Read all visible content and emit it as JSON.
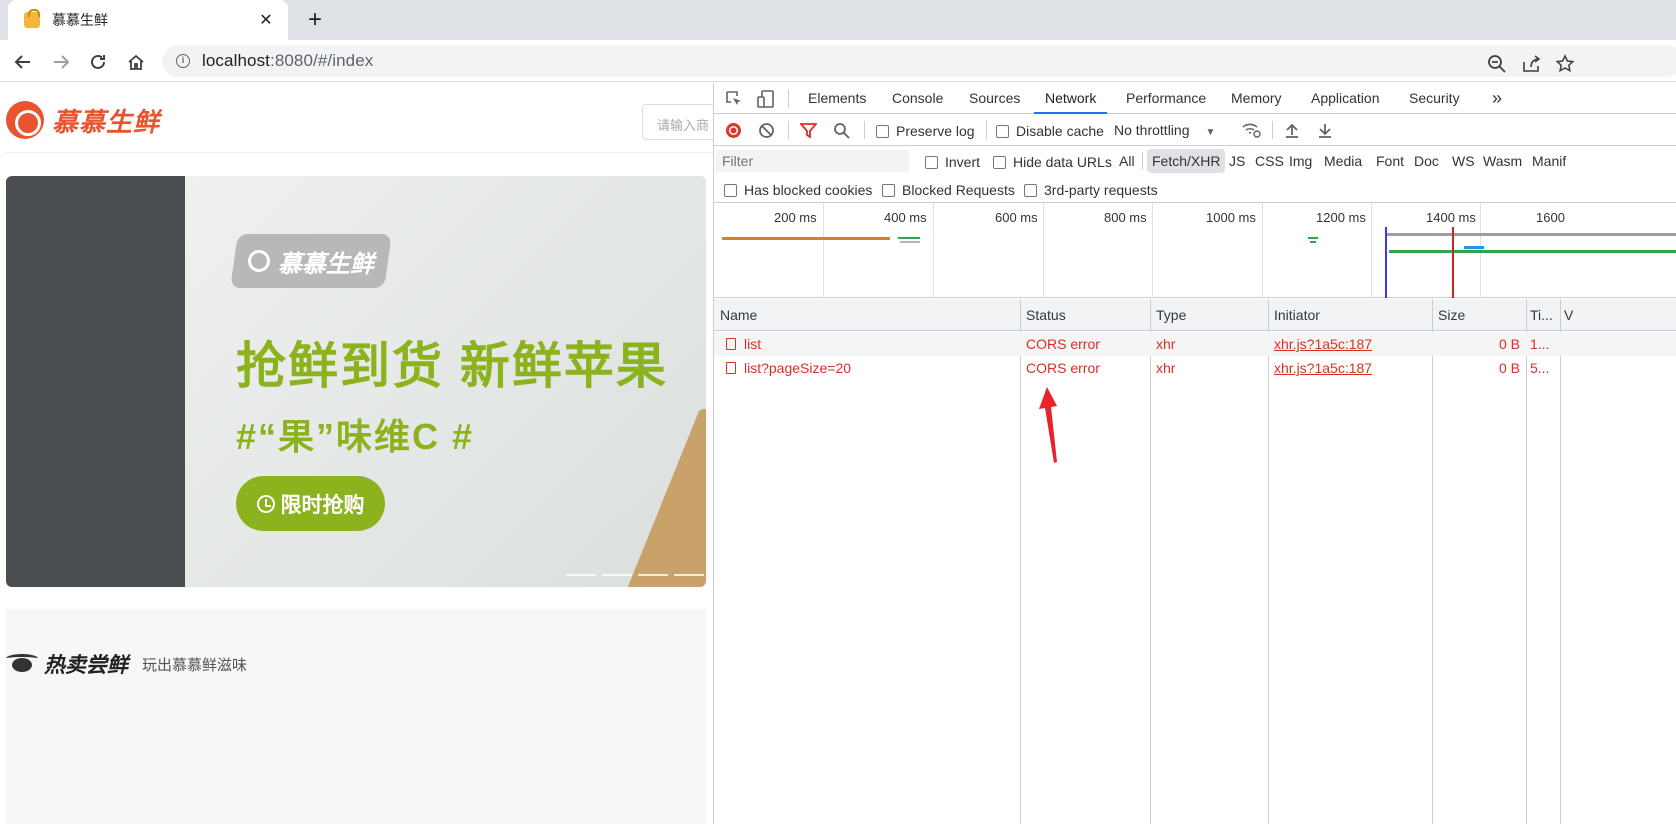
{
  "browser": {
    "tab_title": "慕慕生鲜",
    "tab_close": "✕",
    "new_tab": "+",
    "url_host": "localhost",
    "url_rest": ":8080/#/index"
  },
  "page": {
    "logo_text": "慕慕生鲜",
    "search_placeholder": "请输入商",
    "banner": {
      "badge": "慕慕生鲜",
      "headline": "抢鲜到货  新鲜苹果",
      "subline": "#“果”味维C #",
      "button": "限时抢购"
    },
    "section": {
      "title": "热卖尝鲜",
      "subtitle": "玩出慕慕鲜滋味"
    }
  },
  "devtools": {
    "tabs": [
      "Elements",
      "Console",
      "Sources",
      "Network",
      "Performance",
      "Memory",
      "Application",
      "Security"
    ],
    "active_tab": "Network",
    "more": "»",
    "preserve_log": "Preserve log",
    "disable_cache": "Disable cache",
    "throttling": "No throttling",
    "throttling_caret": "▼",
    "filter_placeholder": "Filter",
    "invert": "Invert",
    "hide_data_urls": "Hide data URLs",
    "types": [
      "All",
      "Fetch/XHR",
      "JS",
      "CSS",
      "Img",
      "Media",
      "Font",
      "Doc",
      "WS",
      "Wasm",
      "Manif"
    ],
    "active_type": "Fetch/XHR",
    "has_blocked_cookies": "Has blocked cookies",
    "blocked_requests": "Blocked Requests",
    "third_party": "3rd-party requests",
    "ticks": [
      "200 ms",
      "400 ms",
      "600 ms",
      "800 ms",
      "1000 ms",
      "1200 ms",
      "1400 ms",
      "1600"
    ],
    "columns": [
      "Name",
      "Status",
      "Type",
      "Initiator",
      "Size",
      "Ti...",
      "V"
    ],
    "rows": [
      {
        "name": "list",
        "status": "CORS error",
        "type": "xhr",
        "initiator": "xhr.js?1a5c:187",
        "size": "0 B",
        "time": "1..."
      },
      {
        "name": "list?pageSize=20",
        "status": "CORS error",
        "type": "xhr",
        "initiator": "xhr.js?1a5c:187",
        "size": "0 B",
        "time": "5..."
      }
    ]
  },
  "colors": {
    "accent": "#1a73e8",
    "error": "#d93025",
    "brand": "#e8542f",
    "banner_green": "#8cb31d",
    "annotation_arrow": "#e8232b"
  }
}
